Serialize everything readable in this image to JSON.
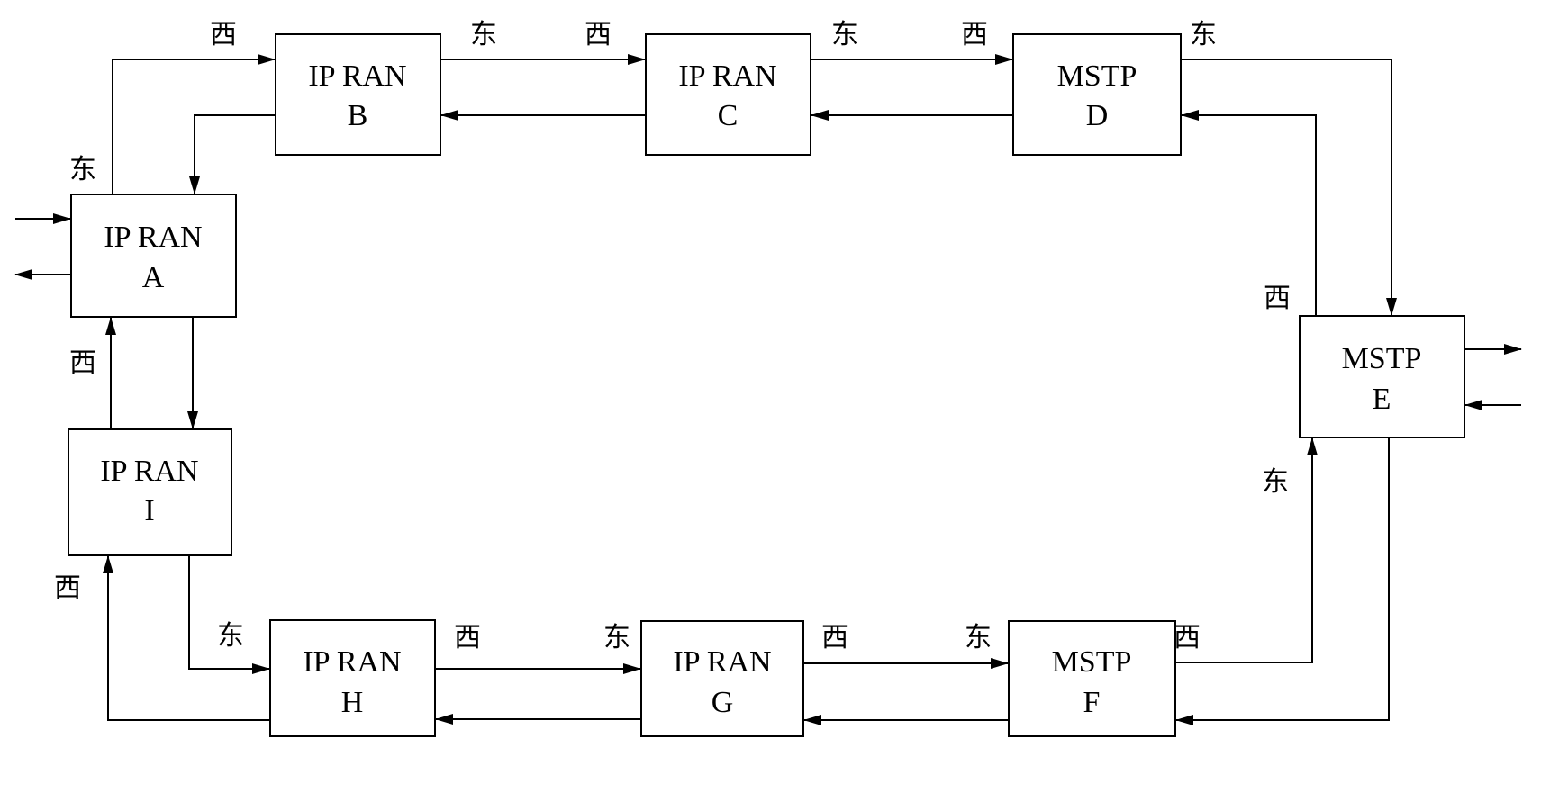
{
  "diagram": {
    "title": "",
    "nodes": [
      {
        "id": "A",
        "line1": "IP RAN",
        "line2": "A",
        "type": "IP RAN"
      },
      {
        "id": "B",
        "line1": "IP RAN",
        "line2": "B",
        "type": "IP RAN"
      },
      {
        "id": "C",
        "line1": "IP RAN",
        "line2": "C",
        "type": "IP RAN"
      },
      {
        "id": "D",
        "line1": "MSTP",
        "line2": "D",
        "type": "MSTP"
      },
      {
        "id": "E",
        "line1": "MSTP",
        "line2": "E",
        "type": "MSTP"
      },
      {
        "id": "F",
        "line1": "MSTP",
        "line2": "F",
        "type": "MSTP"
      },
      {
        "id": "G",
        "line1": "IP RAN",
        "line2": "G",
        "type": "IP RAN"
      },
      {
        "id": "H",
        "line1": "IP RAN",
        "line2": "H",
        "type": "IP RAN"
      },
      {
        "id": "I",
        "line1": "IP RAN",
        "line2": "I",
        "type": "IP RAN"
      }
    ],
    "edges": [
      {
        "from": "A",
        "to": "B",
        "direction": "forward"
      },
      {
        "from": "B",
        "to": "A",
        "direction": "return"
      },
      {
        "from": "B",
        "to": "C",
        "direction": "forward"
      },
      {
        "from": "C",
        "to": "B",
        "direction": "return"
      },
      {
        "from": "C",
        "to": "D",
        "direction": "forward"
      },
      {
        "from": "D",
        "to": "C",
        "direction": "return"
      },
      {
        "from": "D",
        "to": "E",
        "direction": "forward"
      },
      {
        "from": "E",
        "to": "D",
        "direction": "return"
      },
      {
        "from": "E",
        "to": "F",
        "direction": "forward"
      },
      {
        "from": "F",
        "to": "E",
        "direction": "return"
      },
      {
        "from": "F",
        "to": "G",
        "direction": "forward"
      },
      {
        "from": "G",
        "to": "F",
        "direction": "return"
      },
      {
        "from": "G",
        "to": "H",
        "direction": "forward"
      },
      {
        "from": "H",
        "to": "G",
        "direction": "return"
      },
      {
        "from": "H",
        "to": "I",
        "direction": "forward"
      },
      {
        "from": "I",
        "to": "H",
        "direction": "return"
      },
      {
        "from": "I",
        "to": "A",
        "direction": "forward"
      },
      {
        "from": "A",
        "to": "I",
        "direction": "return"
      },
      {
        "from": "external",
        "to": "A",
        "direction": "input"
      },
      {
        "from": "A",
        "to": "external",
        "direction": "output"
      },
      {
        "from": "E",
        "to": "external",
        "direction": "output"
      },
      {
        "from": "external",
        "to": "E",
        "direction": "input"
      }
    ],
    "port_labels": {
      "east": "东",
      "west": "西"
    },
    "ports": [
      {
        "node": "A",
        "side": "top",
        "label": "东"
      },
      {
        "node": "B",
        "side": "left",
        "label": "西"
      },
      {
        "node": "B",
        "side": "right",
        "label": "东"
      },
      {
        "node": "C",
        "side": "left",
        "label": "西"
      },
      {
        "node": "C",
        "side": "right",
        "label": "东"
      },
      {
        "node": "D",
        "side": "left",
        "label": "西"
      },
      {
        "node": "D",
        "side": "right",
        "label": "东"
      },
      {
        "node": "E",
        "side": "top",
        "label": "西"
      },
      {
        "node": "E",
        "side": "bottom",
        "label": "东"
      },
      {
        "node": "F",
        "side": "right",
        "label": "西"
      },
      {
        "node": "F",
        "side": "left",
        "label": "东"
      },
      {
        "node": "G",
        "side": "right",
        "label": "西"
      },
      {
        "node": "G",
        "side": "left",
        "label": "东"
      },
      {
        "node": "H",
        "side": "right",
        "label": "西"
      },
      {
        "node": "H",
        "side": "left",
        "label": "东"
      },
      {
        "node": "I",
        "side": "bottom",
        "label": "西"
      },
      {
        "node": "A",
        "side": "bottom",
        "label": "西"
      }
    ],
    "colors": {
      "stroke": "#000000",
      "background": "#ffffff"
    }
  }
}
